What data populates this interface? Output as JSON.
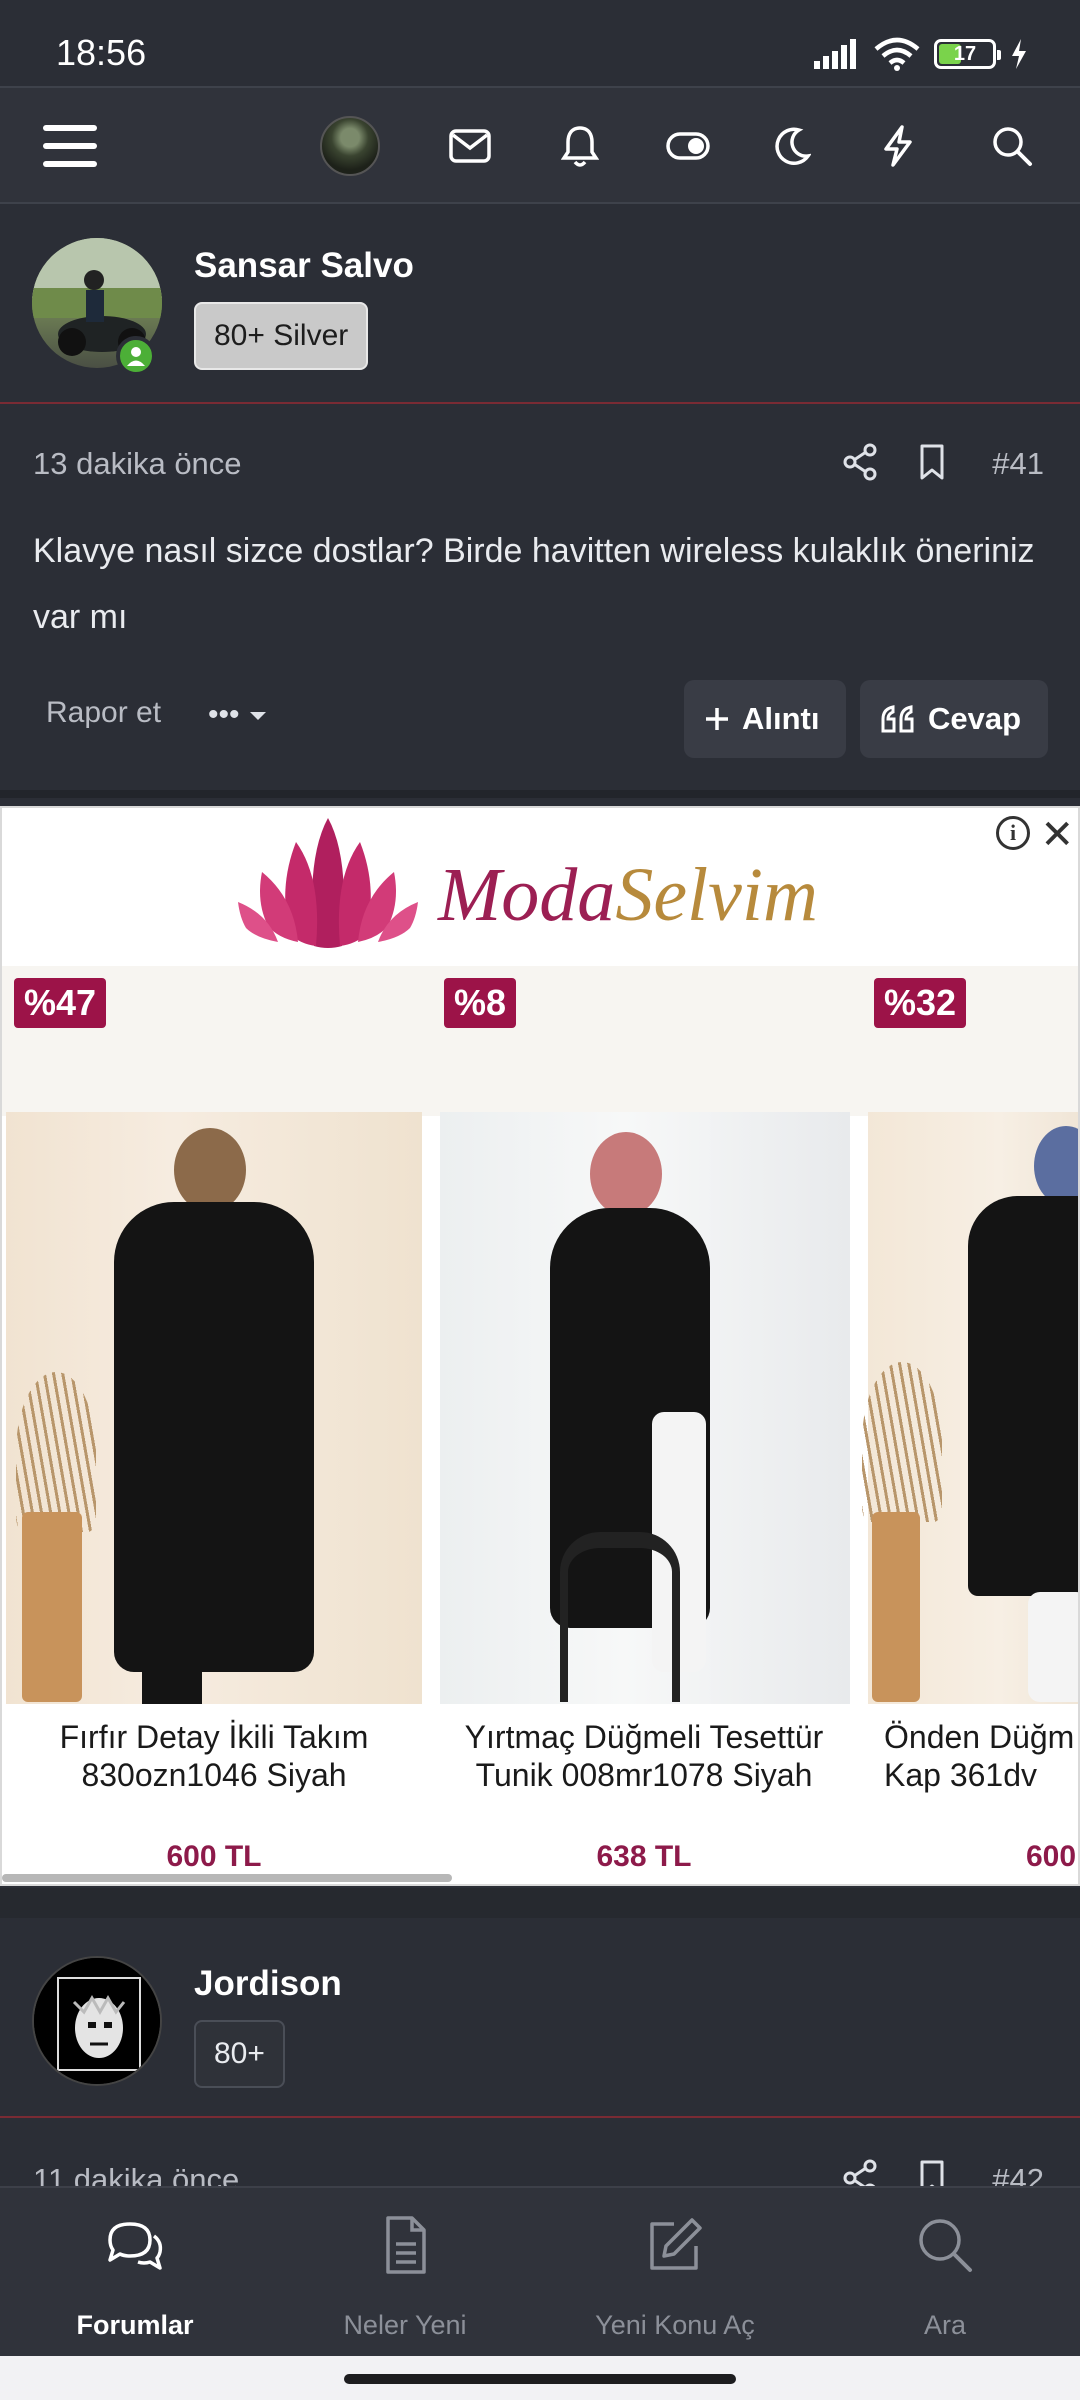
{
  "status_bar": {
    "time": "18:56",
    "battery": "17"
  },
  "post1": {
    "username": "Sansar Salvo",
    "badge": "80+ Silver",
    "time_ago": "13 dakika önce",
    "post_number": "#41",
    "body": "Klavye nasıl sizce dostlar? Birde havitten wireless kulaklık öneriniz var mı",
    "report_label": "Rapor et",
    "more_label": "•••",
    "quote_label": "Alıntı",
    "reply_label": "Cevap"
  },
  "ad": {
    "brand_part1": "Moda",
    "brand_part2": "Selvim",
    "info_icon": "i",
    "close_icon": "✕",
    "products": [
      {
        "discount": "%47",
        "name": "Fırfır Detay İkili Takım 830ozn1046 Siyah",
        "price": "600 TL"
      },
      {
        "discount": "%8",
        "name": "Yırtmaç Düğmeli Tesettür Tunik 008mr1078 Siyah",
        "price": "638 TL"
      },
      {
        "discount": "%32",
        "name": "Önden Düğm Kap 361dv",
        "price": "600"
      }
    ]
  },
  "post2": {
    "username": "Jordison",
    "badge": "80+",
    "time_ago": "11 dakika önce",
    "post_number": "#42"
  },
  "bottom_nav": [
    {
      "label": "Forumlar",
      "icon": "forums-icon",
      "active": true
    },
    {
      "label": "Neler Yeni",
      "icon": "document-icon",
      "active": false
    },
    {
      "label": "Yeni Konu Aç",
      "icon": "edit-icon",
      "active": false
    },
    {
      "label": "Ara",
      "icon": "search-icon",
      "active": false
    }
  ],
  "colors": {
    "background": "#2b2e36",
    "accent_line": "#7a2b34",
    "brand_magenta": "#9c1f53",
    "brand_gold": "#b78a3c",
    "online": "#4caf37"
  }
}
